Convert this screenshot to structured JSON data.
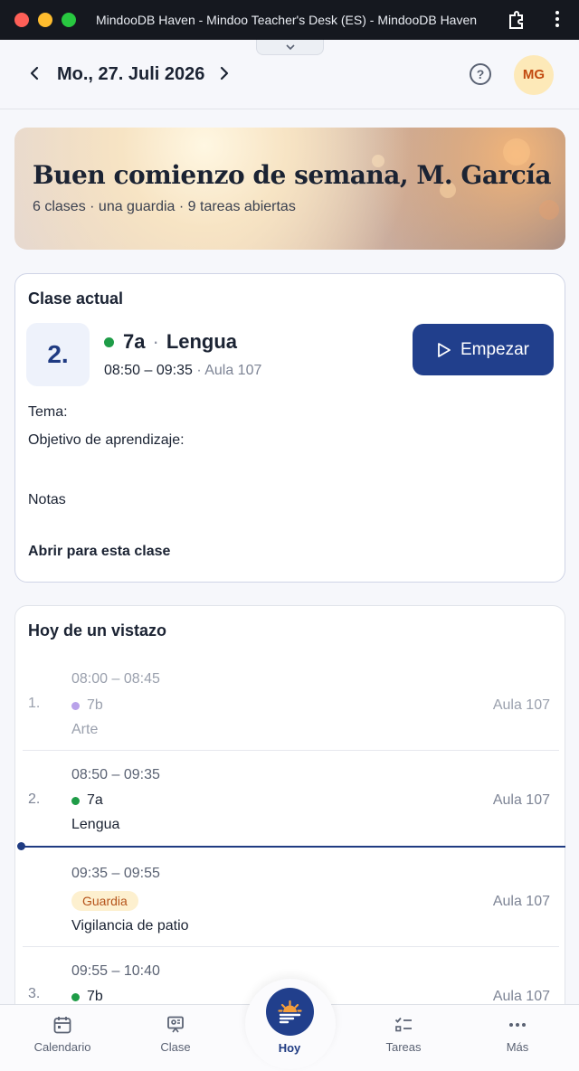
{
  "window": {
    "title": "MindooDB Haven - Mindoo Teacher's Desk (ES) - MindooDB Haven"
  },
  "header": {
    "date": "Mo., 27. Juli 2026",
    "help_icon": "?",
    "avatar_initials": "MG"
  },
  "hero": {
    "title": "Buen comienzo de semana, M. García",
    "subtitle": "6 clases · una guardia · 9 tareas abiertas"
  },
  "current_class": {
    "heading": "Clase actual",
    "period": "2.",
    "group": "7a",
    "separator": "·",
    "subject": "Lengua",
    "time": "08:50 – 09:35",
    "room": " · Aula 107",
    "start_label": "Empezar",
    "topic_label": "Tema:",
    "objective_label": "Objetivo de aprendizaje:",
    "notes_label": "Notas",
    "open_label": "Abrir para esta clase",
    "colors": {
      "accent": "#213f8c",
      "status": "#1e9c47"
    }
  },
  "glance": {
    "heading": "Hoy de un vistazo",
    "rows": [
      {
        "num": "1.",
        "time": "08:00 – 08:45",
        "group": "7b",
        "subject": "Arte",
        "room": "Aula 107",
        "dot": "#b9a2ea",
        "state": "past"
      },
      {
        "num": "2.",
        "time": "08:50 – 09:35",
        "group": "7a",
        "subject": "Lengua",
        "room": "Aula 107",
        "dot": "#1e9c47",
        "state": "current"
      },
      {
        "num": "",
        "time": "09:35 – 09:55",
        "badge": "Guardia",
        "subject": "Vigilancia de patio",
        "room": "Aula 107",
        "state": "duty"
      },
      {
        "num": "3.",
        "time": "09:55 – 10:40",
        "group": "7b",
        "subject": "",
        "room": "Aula 107",
        "dot": "#1e9c47",
        "state": "upcoming"
      }
    ]
  },
  "tabs": [
    {
      "label": "Calendario",
      "icon": "calendar-icon"
    },
    {
      "label": "Clase",
      "icon": "presentation-icon"
    },
    {
      "label": "Hoy",
      "icon": "sunrise-icon",
      "active": true
    },
    {
      "label": "Tareas",
      "icon": "checklist-icon"
    },
    {
      "label": "Más",
      "icon": "more-icon"
    }
  ]
}
